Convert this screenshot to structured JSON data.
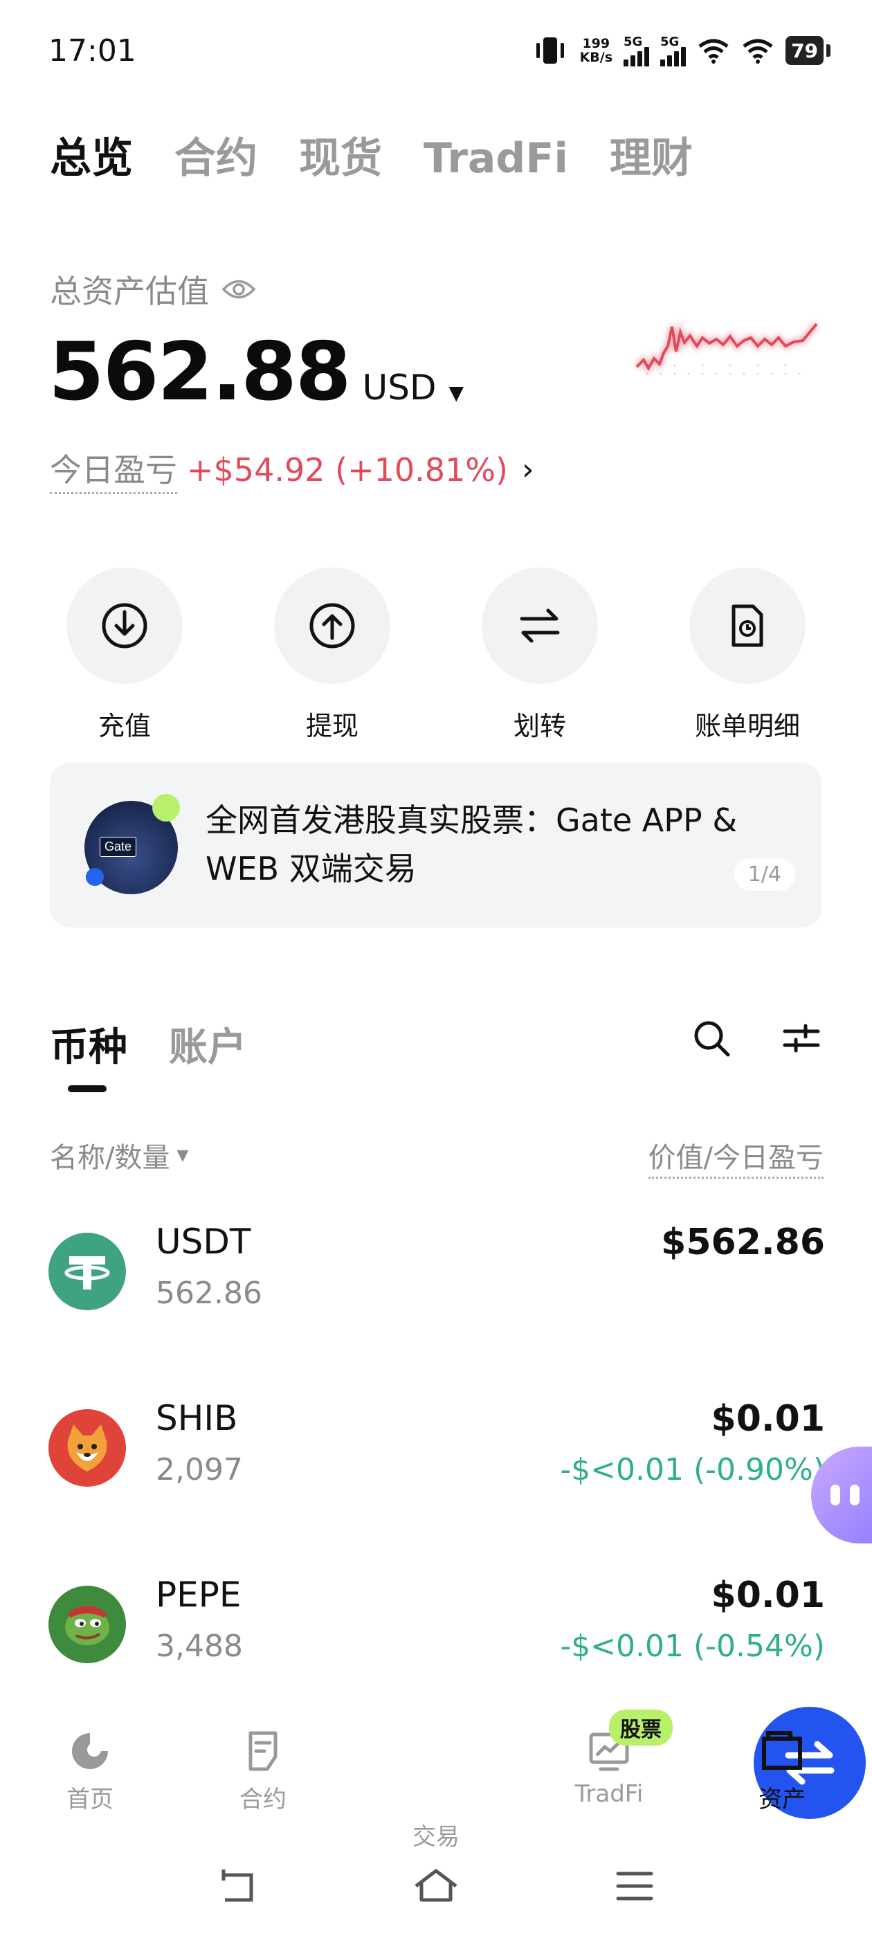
{
  "status_bar": {
    "time": "17:01",
    "net_speed_value": "199",
    "net_speed_unit": "KB/s",
    "signal1": "5G",
    "signal2": "5G",
    "battery": "79"
  },
  "top_tabs": [
    "总览",
    "合约",
    "现货",
    "TradFi",
    "理财"
  ],
  "summary": {
    "label": "总资产估值",
    "total_value": "562.88",
    "currency": "USD",
    "pnl_label": "今日盈亏",
    "pnl_value": "+$54.92 (+10.81%)"
  },
  "actions": [
    {
      "label": "充值",
      "icon": "deposit-icon"
    },
    {
      "label": "提现",
      "icon": "withdraw-icon"
    },
    {
      "label": "划转",
      "icon": "transfer-icon"
    },
    {
      "label": "账单明细",
      "icon": "bill-icon"
    }
  ],
  "banner": {
    "text": "全网首发港股真实股票：Gate APP & WEB 双端交易",
    "image_tag": "Gate",
    "page": "1/4"
  },
  "asset_tabs": [
    "币种",
    "账户"
  ],
  "list_header": {
    "left": "名称/数量",
    "right": "价值/今日盈亏"
  },
  "coins": [
    {
      "name": "USDT",
      "qty": "562.86",
      "value": "$562.86",
      "change": ""
    },
    {
      "name": "SHIB",
      "qty": "2,097",
      "value": "$0.01",
      "change": "-$<0.01 (-0.90%)"
    },
    {
      "name": "PEPE",
      "qty": "3,488",
      "value": "$0.01",
      "change": "-$<0.01 (-0.54%)"
    }
  ],
  "bottom_nav": {
    "items": [
      "首页",
      "合约",
      "交易",
      "TradFi",
      "资产"
    ],
    "badge": "股票"
  },
  "colors": {
    "accent_blue": "#2354f0",
    "profit_red": "#e24a5a",
    "loss_green": "#2eb087",
    "badge_green": "#b9f06a"
  }
}
